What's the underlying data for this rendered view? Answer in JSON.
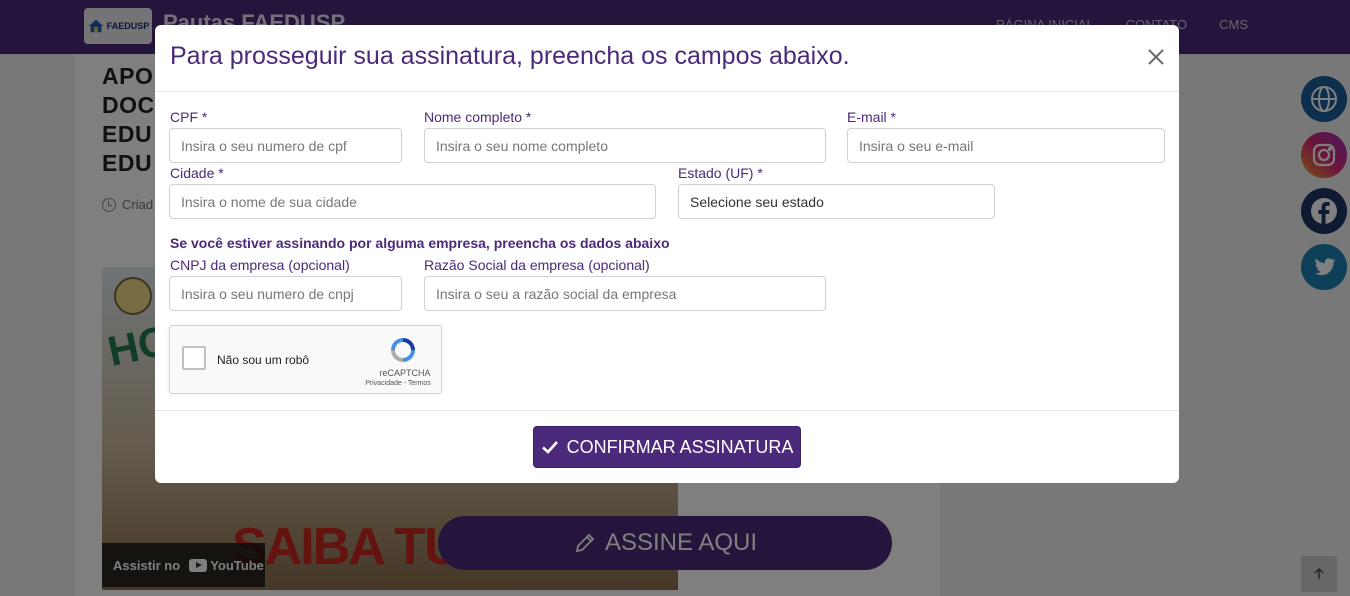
{
  "site": {
    "logo_text": "FAEDUSP",
    "title": "Pautas FAEDUSP",
    "nav": [
      "PÁGINA INICIAL",
      "CONTATO",
      "CMS"
    ]
  },
  "article": {
    "title_lines": [
      "APO",
      "DOC",
      "EDU",
      "EDU"
    ],
    "created_label": "Criad"
  },
  "video": {
    "watch_on": "Assistir no",
    "youtube": "YouTube",
    "overlay_text_1": "HO",
    "overlay_text_2": "SAIBA TUDO!"
  },
  "cta": {
    "assine_label": "ASSINE AQUI"
  },
  "modal": {
    "title": "Para prosseguir sua assinatura, preencha os campos abaixo.",
    "fields": {
      "cpf": {
        "label": "CPF *",
        "placeholder": "Insira o seu numero de cpf"
      },
      "nome": {
        "label": "Nome completo *",
        "placeholder": "Insira o seu nome completo"
      },
      "email": {
        "label": "E-mail *",
        "placeholder": "Insira o seu e-mail"
      },
      "cidade": {
        "label": "Cidade *",
        "placeholder": "Insira o nome de sua cidade"
      },
      "estado": {
        "label": "Estado (UF) *",
        "selected": "Selecione seu estado"
      },
      "cnpj": {
        "label": "CNPJ da empresa (opcional)",
        "placeholder": "Insira o seu numero de cnpj"
      },
      "razao": {
        "label": "Razão Social da empresa (opcional)",
        "placeholder": "Insira o seu a razão social da empresa"
      }
    },
    "company_note": "Se você estiver assinando por alguma empresa, preencha os dados abaixo",
    "recaptcha": {
      "label": "Não sou um robô",
      "brand": "reCAPTCHA",
      "links": "Privacidade - Termos"
    },
    "confirm_label": "CONFIRMAR ASSINATURA"
  },
  "colors": {
    "brand_purple": "#4b2a7b",
    "overlay": "rgba(0,0,0,0.5)"
  },
  "icons": [
    "home-logo-icon",
    "clock-icon",
    "youtube-icon",
    "pencil-icon",
    "globe-icon",
    "instagram-icon",
    "facebook-icon",
    "twitter-icon",
    "arrow-up-icon",
    "close-icon",
    "check-icon",
    "recaptcha-icon"
  ]
}
